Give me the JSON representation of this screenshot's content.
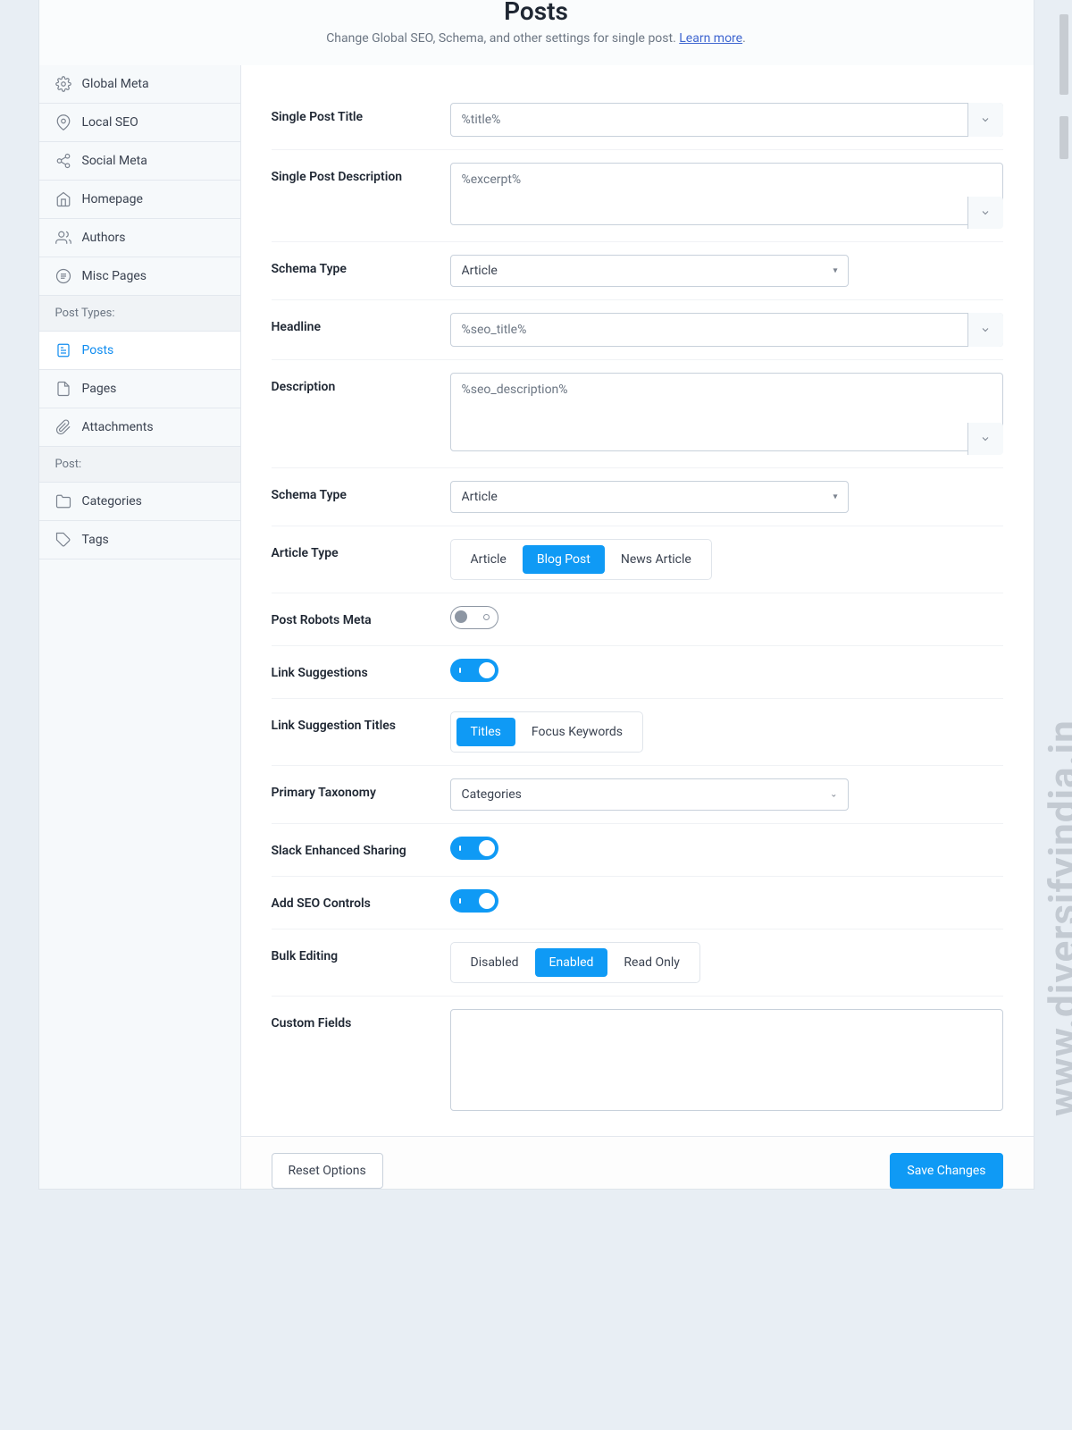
{
  "header": {
    "title": "Posts",
    "sub_pre": "Change Global SEO, Schema, and other settings for single post. ",
    "learn": "Learn more"
  },
  "sidebar": {
    "items": [
      "Global Meta",
      "Local SEO",
      "Social Meta",
      "Homepage",
      "Authors",
      "Misc Pages"
    ],
    "head1": "Post Types:",
    "ptypes": [
      "Posts",
      "Pages",
      "Attachments"
    ],
    "head2": "Post:",
    "post": [
      "Categories",
      "Tags"
    ]
  },
  "form": {
    "single_title": {
      "label": "Single Post Title",
      "value": "%title%"
    },
    "single_desc": {
      "label": "Single Post Description",
      "value": "%excerpt%"
    },
    "schema1": {
      "label": "Schema Type",
      "value": "Article"
    },
    "headline": {
      "label": "Headline",
      "value": "%seo_title%"
    },
    "desc": {
      "label": "Description",
      "value": "%seo_description%"
    },
    "schema2": {
      "label": "Schema Type",
      "value": "Article"
    },
    "article_type": {
      "label": "Article Type",
      "opts": [
        "Article",
        "Blog Post",
        "News Article"
      ],
      "sel": 1
    },
    "robots": {
      "label": "Post Robots Meta",
      "on": false
    },
    "linksug": {
      "label": "Link Suggestions",
      "on": true
    },
    "linksugt": {
      "label": "Link Suggestion Titles",
      "opts": [
        "Titles",
        "Focus Keywords"
      ],
      "sel": 0
    },
    "taxonomy": {
      "label": "Primary Taxonomy",
      "value": "Categories"
    },
    "slack": {
      "label": "Slack Enhanced Sharing",
      "on": true
    },
    "seoctl": {
      "label": "Add SEO Controls",
      "on": true
    },
    "bulk": {
      "label": "Bulk Editing",
      "opts": [
        "Disabled",
        "Enabled",
        "Read Only"
      ],
      "sel": 1
    },
    "custom": {
      "label": "Custom Fields"
    }
  },
  "footer": {
    "reset": "Reset Options",
    "save": "Save Changes"
  },
  "watermark": "www.diversifyindia.in"
}
